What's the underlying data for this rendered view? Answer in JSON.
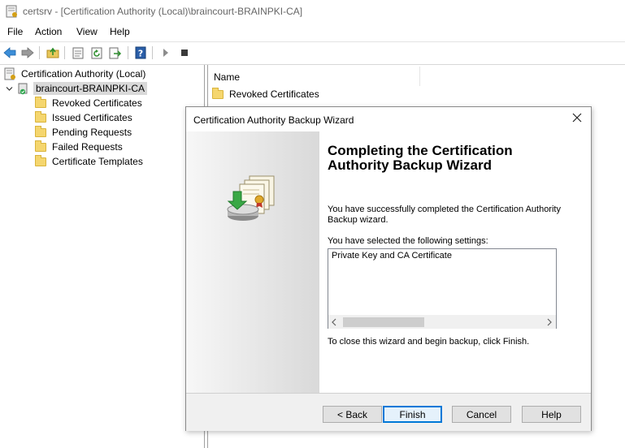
{
  "window": {
    "title": "certsrv - [Certification Authority (Local)\\braincourt-BRAINPKI-CA]"
  },
  "menu": [
    "File",
    "Action",
    "View",
    "Help"
  ],
  "toolbar": {
    "buttons": [
      "back-icon",
      "forward-icon",
      "up-folder-icon",
      "properties-icon",
      "refresh-icon",
      "export-list-icon",
      "help-icon",
      "start-service-icon",
      "stop-service-icon"
    ]
  },
  "tree": {
    "root": "Certification Authority (Local)",
    "ca": "braincourt-BRAINPKI-CA",
    "items": [
      "Revoked Certificates",
      "Issued Certificates",
      "Pending Requests",
      "Failed Requests",
      "Certificate Templates"
    ]
  },
  "list": {
    "column_name": "Name",
    "rows": [
      "Revoked Certificates"
    ]
  },
  "dialog": {
    "title": "Certification Authority Backup Wizard",
    "heading_line1": "Completing the Certification",
    "heading_line2": "Authority Backup Wizard",
    "success_line1": "You have successfully completed the Certification Authority",
    "success_line2": "Backup wizard.",
    "settings_label": "You have selected the following settings:",
    "settings_value": "Private Key and CA Certificate",
    "close_note": "To close this wizard and begin backup, click Finish.",
    "buttons": {
      "back": "< Back",
      "finish": "Finish",
      "cancel": "Cancel",
      "help": "Help"
    }
  },
  "colors": {
    "accent": "#0078d7",
    "selection": "#d9d9d9",
    "folder": "#f5d66e"
  }
}
